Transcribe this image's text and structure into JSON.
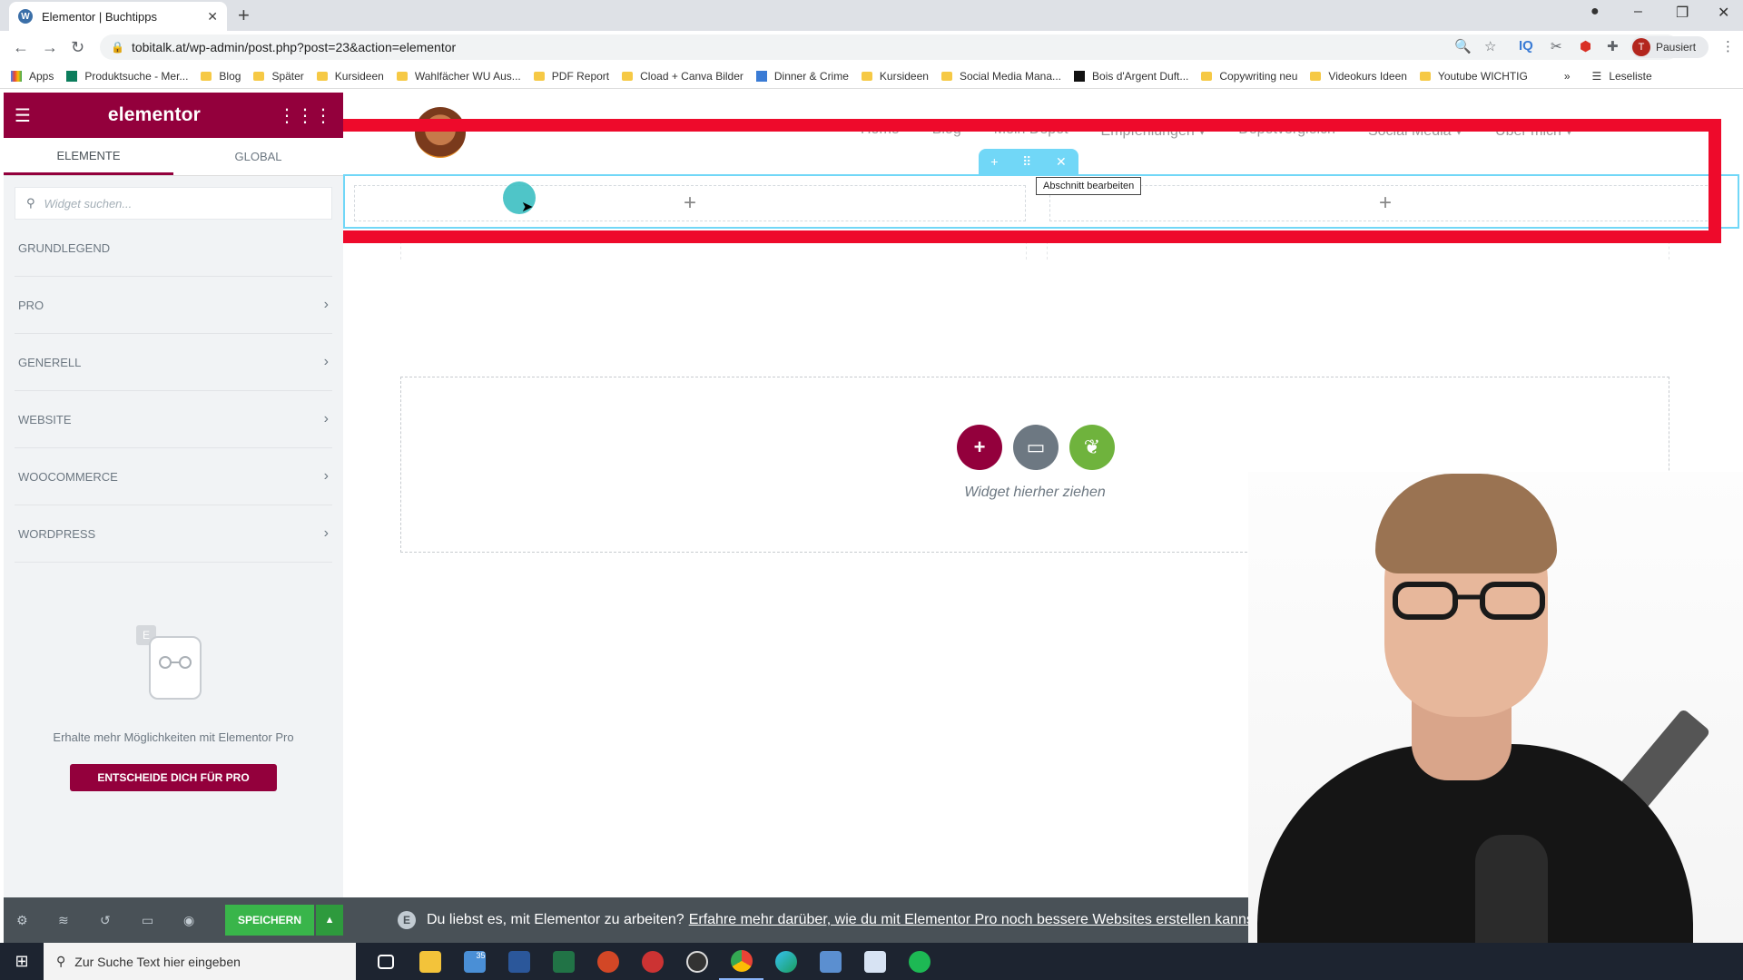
{
  "browser": {
    "tab_title": "Elementor | Buchtipps",
    "url": "tobitalk.at/wp-admin/post.php?post=23&action=elementor",
    "profile_label": "Pausiert",
    "profile_initial": "T",
    "bookmarks": [
      "Apps",
      "Produktsuche - Mer...",
      "Blog",
      "Später",
      "Kursideen",
      "Wahlfächer WU Aus...",
      "PDF Report",
      "Cload + Canva Bilder",
      "Dinner & Crime",
      "Kursideen",
      "Social Media Mana...",
      "Bois d'Argent Duft...",
      "Copywriting neu",
      "Videokurs Ideen",
      "Youtube WICHTIG"
    ],
    "reading_list": "Leseliste"
  },
  "panel": {
    "logo": "elementor",
    "tabs": [
      "ELEMENTE",
      "GLOBAL"
    ],
    "search_placeholder": "Widget suchen...",
    "categories": [
      "GRUNDLEGEND",
      "PRO",
      "GENERELL",
      "WEBSITE",
      "WOOCOMMERCE",
      "WORDPRESS"
    ],
    "promo_text": "Erhalte mehr Möglichkeiten mit Elementor Pro",
    "promo_button": "ENTSCHEIDE DICH FÜR PRO",
    "save_label": "SPEICHERN"
  },
  "canvas": {
    "nav": [
      "Home",
      "Blog",
      "Mein Depot",
      "Empfehlungen",
      "Depotvergleich",
      "Social Media",
      "Über mich"
    ],
    "tooltip": "Abschnitt bearbeiten",
    "dropzone_label": "Widget hierher ziehen",
    "accent_color": "#ee0a2b"
  },
  "notice": {
    "text": "Du liebst es, mit Elementor zu arbeiten?",
    "link": "Erfahre mehr darüber, wie du mit Elementor Pro noch bessere Websites erstellen kannst."
  },
  "taskbar": {
    "search_placeholder": "Zur Suche Text hier eingeben",
    "mail_badge": "35"
  }
}
